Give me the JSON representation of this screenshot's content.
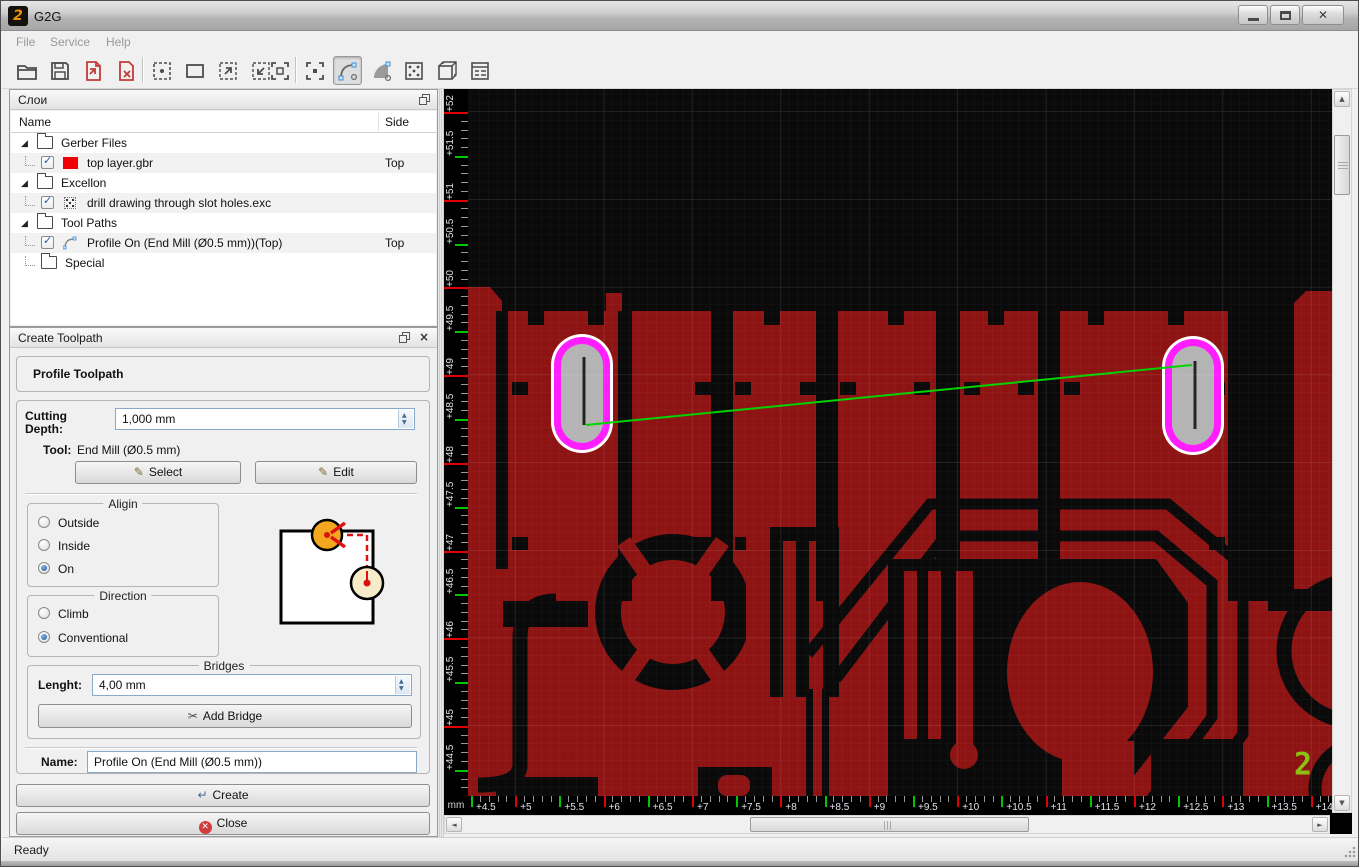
{
  "window": {
    "title": "G2G",
    "controls": [
      "minimize",
      "maximize",
      "close"
    ]
  },
  "menubar": {
    "items": [
      "File",
      "Service",
      "Help"
    ]
  },
  "toolbar": {
    "buttons": [
      "open",
      "save",
      "import-gerber",
      "close-file",
      "zoom-fit",
      "zoom-window",
      "zoom-in",
      "zoom-out",
      "zoom-selection",
      "select-region",
      "profile-tool",
      "pocket-tool",
      "drill-tool",
      "board-3d",
      "properties"
    ],
    "active_button": "profile-tool"
  },
  "icons": {
    "check": "✓",
    "expander": "◢",
    "scissors": "✂",
    "pencil": "✎",
    "close": "×",
    "return_arrow": "↵",
    "up": "▲",
    "down": "▼",
    "left": "◄",
    "right": "►"
  },
  "layers_panel": {
    "title": "Слои",
    "columns": [
      "Name",
      "Side"
    ],
    "rows": [
      {
        "kind": "group",
        "label": "Gerber Files",
        "expanded": true
      },
      {
        "kind": "layer",
        "checked": true,
        "icon": "color-swatch",
        "swatch": "#f00000",
        "label": "top layer.gbr",
        "side": "Top"
      },
      {
        "kind": "group",
        "label": "Excellon",
        "expanded": true
      },
      {
        "kind": "layer",
        "checked": true,
        "icon": "drill",
        "label": "drill drawing through slot holes.exc",
        "side": ""
      },
      {
        "kind": "group",
        "label": "Tool Paths",
        "expanded": true
      },
      {
        "kind": "layer",
        "checked": true,
        "icon": "toolpath",
        "label": "Profile On (End Mill (Ø0.5 mm))(Top)",
        "side": "Top"
      },
      {
        "kind": "folder",
        "label": "Special"
      }
    ]
  },
  "toolpath_panel": {
    "title": "Create Toolpath",
    "profile_header": "Profile Toolpath",
    "cutting_depth_label": "Cutting Depth:",
    "cutting_depth_value": "1,000 mm",
    "tool_label": "Tool:",
    "tool_value": "End Mill (Ø0.5 mm)",
    "select_button": "Select",
    "edit_button": "Edit",
    "align_group": {
      "title": "Aligin",
      "options": [
        {
          "label": "Outside",
          "selected": false
        },
        {
          "label": "Inside",
          "selected": false
        },
        {
          "label": "On",
          "selected": true
        }
      ]
    },
    "direction_group": {
      "title": "Direction",
      "options": [
        {
          "label": "Climb",
          "selected": false
        },
        {
          "label": "Conventional",
          "selected": true
        }
      ]
    },
    "bridges_group": {
      "title": "Bridges",
      "length_label": "Lenght:",
      "length_value": "4,00 mm",
      "add_button": "Add Bridge"
    },
    "name_label": "Name:",
    "name_value": "Profile On (End Mill (Ø0.5 mm))",
    "create_button": "Create",
    "close_button": "Close"
  },
  "statusbar": {
    "text": "Ready"
  },
  "canvas": {
    "unit": "mm",
    "h_ruler_labels": [
      "+4.5",
      "+5",
      "+5.5",
      "+6",
      "+6.5",
      "+7",
      "+7.5",
      "+8",
      "+8.5",
      "+9",
      "+9.5",
      "+10",
      "+10.5",
      "+11",
      "+11.5",
      "+12",
      "+12.5",
      "+13",
      "+13.5",
      "+14"
    ],
    "v_ruler_labels": [
      "+52",
      "+51.5",
      "+51",
      "+50.5",
      "+50",
      "+49.5",
      "+49",
      "+48.5",
      "+48",
      "+47.5",
      "+47",
      "+46.5",
      "+46",
      "+45.5",
      "+45",
      "+44.5"
    ],
    "hud_digit": "2",
    "colors": {
      "copper": "#8e1414",
      "toolpath_green": "#00d200",
      "slot_ring": "#ff1cff",
      "tick_red": "#e00000",
      "tick_green": "#00c800"
    }
  }
}
